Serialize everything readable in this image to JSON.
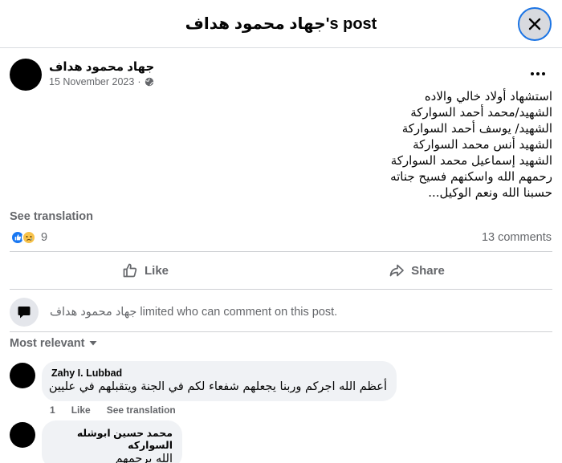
{
  "header": {
    "title": "جهاد محمود هداف's post"
  },
  "post": {
    "author": "جهاد محمود هداف",
    "date": "15 November 2023",
    "separator": "·",
    "lines": [
      "استشهاد أولاد خالي والاده",
      "الشهيد/محمد أحمد السواركة",
      "الشهيد/ يوسف أحمد السواركة",
      "الشهيد أنس محمد السواركة",
      "الشهيد إسماعيل محمد السواركة",
      "رحمهم الله واسكنهم فسيح جناته",
      "حسبنا الله ونعم الوكيل..."
    ],
    "see_translation": "See translation",
    "reaction_count": "9",
    "comments_count": "13 comments"
  },
  "actions": {
    "like": "Like",
    "share": "Share"
  },
  "limited_notice": {
    "name": "جهاد محمود هداف",
    "text": "limited who can comment on this post."
  },
  "sort_label": "Most relevant",
  "comments": [
    {
      "author": "Zahy I. Lubbad",
      "text": "أعظم الله اجركم وربنا يجعلهم شفعاء لكم في الجنة ويتقبلهم في عليين",
      "likes": "1",
      "like_label": "Like",
      "translate_label": "See translation"
    },
    {
      "author": "محمد حسين ابوشله السواركه",
      "text": "الله يرحمهم"
    }
  ],
  "icons": {
    "close": "close-icon",
    "globe": "globe-icon",
    "more": "more-icon",
    "like": "thumbs-up-icon",
    "share": "share-icon",
    "comment_limited": "comment-bubble-icon",
    "caret": "caret-down-icon"
  },
  "colors": {
    "accent": "#1877f2",
    "muted": "#65676b",
    "bubble": "#f0f2f5"
  }
}
